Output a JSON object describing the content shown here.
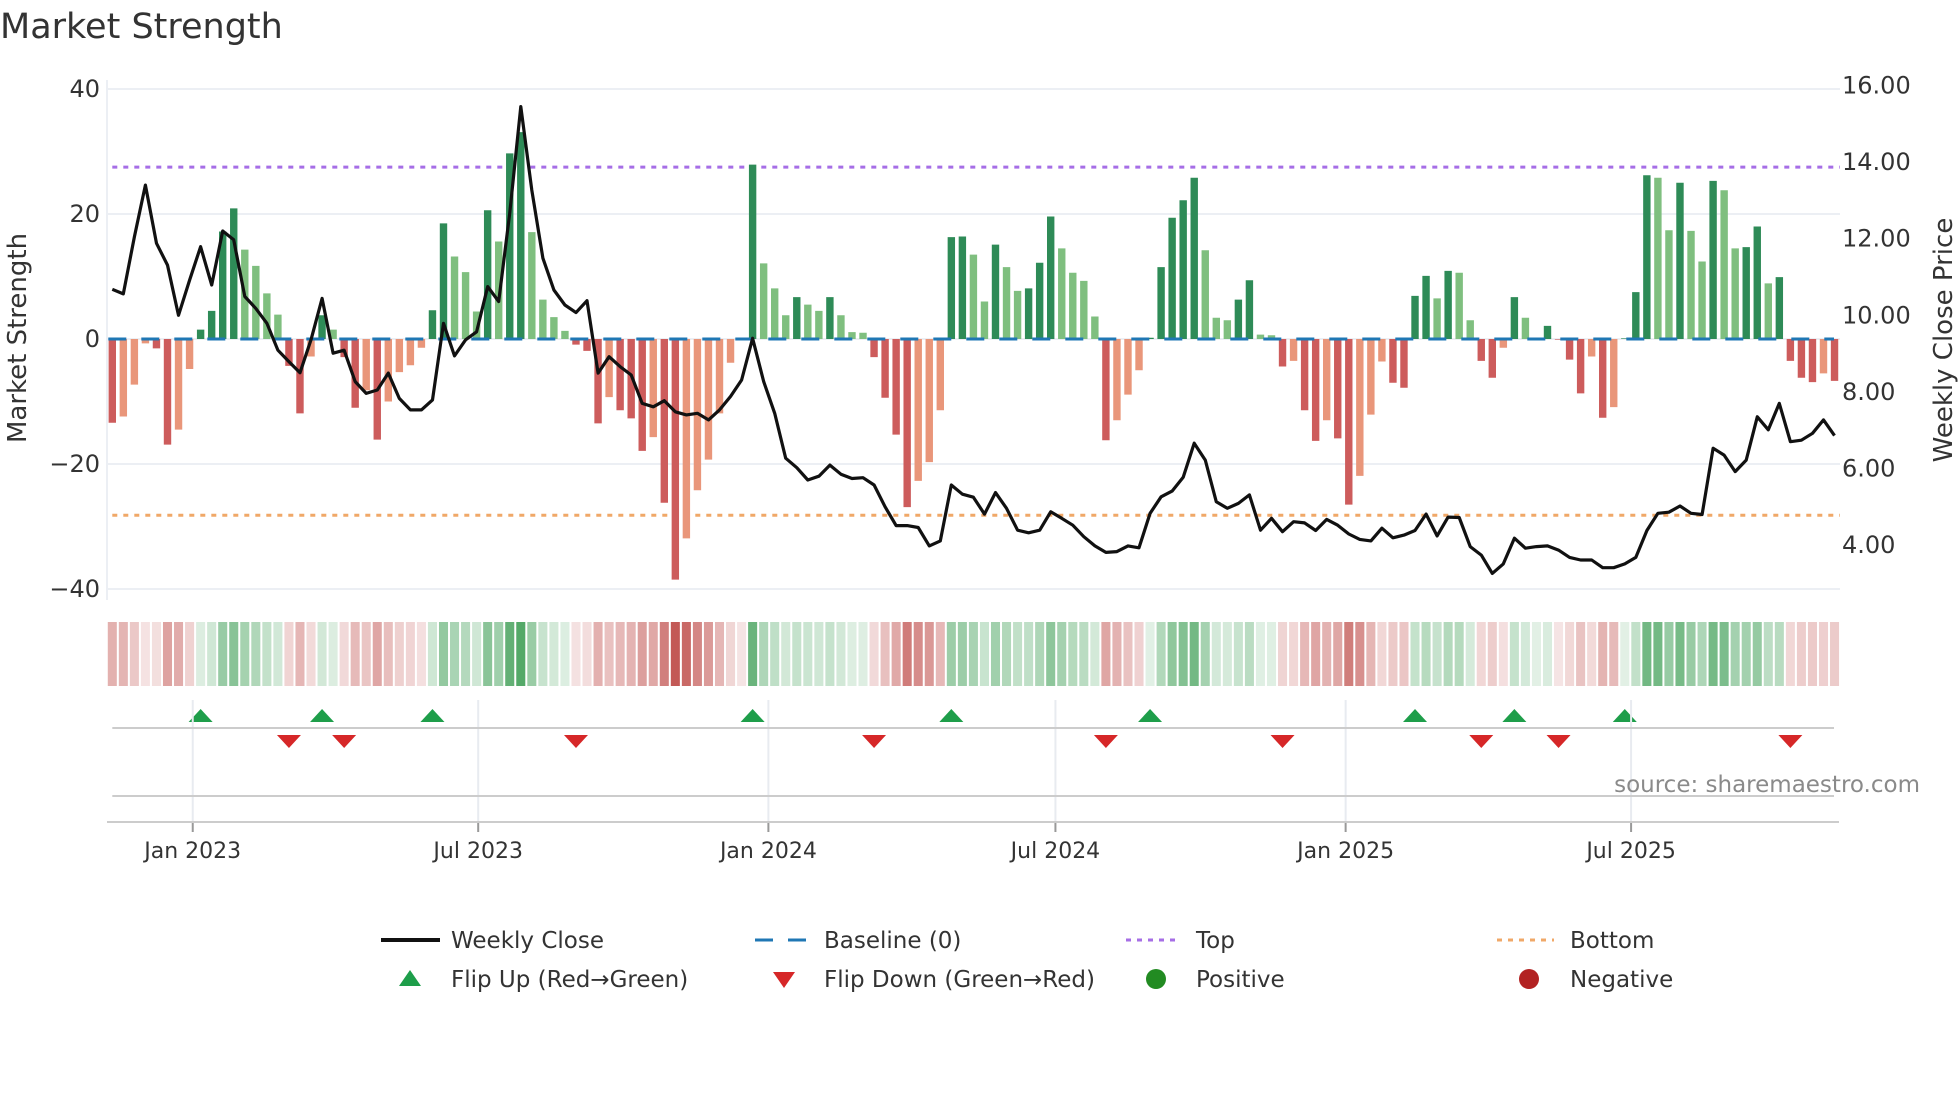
{
  "chart_data": {
    "type": "bar",
    "title": "Market Strength",
    "source": "source: sharemaestro.com",
    "x_start_week": "2022-11-11",
    "x_step_days": 7,
    "x_ticks": [
      {
        "date": "2023-01-01",
        "label": "Jan 2023"
      },
      {
        "date": "2023-07-01",
        "label": "Jul 2023"
      },
      {
        "date": "2024-01-01",
        "label": "Jan 2024"
      },
      {
        "date": "2024-07-01",
        "label": "Jul 2024"
      },
      {
        "date": "2025-01-01",
        "label": "Jan 2025"
      },
      {
        "date": "2025-07-01",
        "label": "Jul 2025"
      }
    ],
    "y_left": {
      "label": "Market Strength",
      "ylim": [
        -41.5,
        43
      ],
      "ticks": [
        40,
        20,
        0,
        -20,
        -40
      ],
      "tick_labels": [
        "40",
        "20",
        "0",
        "−20",
        "−40"
      ]
    },
    "y_right": {
      "label": "Weekly Close Price",
      "ylim": [
        2.62,
        16.4
      ],
      "ticks": [
        16,
        14,
        12,
        10,
        8,
        6,
        4
      ],
      "tick_labels": [
        "16.00",
        "14.00",
        "12.00",
        "10.00",
        "8.00",
        "6.00",
        "4.00"
      ]
    },
    "thresholds": {
      "top": 27.5,
      "bottom": -28.2,
      "baseline": 0
    },
    "strength": [
      -13.4,
      -12.4,
      -7.3,
      -0.7,
      -1.5,
      -16.9,
      -14.5,
      -4.8,
      1.5,
      4.5,
      17.2,
      20.9,
      14.3,
      11.7,
      7.3,
      3.9,
      -4.3,
      -11.9,
      -2.8,
      3.8,
      1.5,
      -2.9,
      -11.0,
      -8.2,
      -16.1,
      -10.0,
      -5.3,
      -4.2,
      -1.4,
      4.6,
      18.5,
      13.2,
      10.7,
      4.4,
      20.6,
      15.6,
      29.7,
      33.1,
      17.1,
      6.3,
      3.5,
      1.3,
      -0.9,
      -1.9,
      -13.5,
      -9.3,
      -11.4,
      -12.7,
      -17.9,
      -15.7,
      -26.2,
      -38.5,
      -31.9,
      -24.2,
      -19.3,
      -11.9,
      -3.8,
      -0.1,
      27.9,
      12.1,
      8.1,
      3.8,
      6.7,
      5.5,
      4.5,
      6.7,
      3.8,
      1.1,
      1.0,
      -2.9,
      -9.4,
      -15.3,
      -26.9,
      -22.7,
      -19.7,
      -11.4,
      16.3,
      16.4,
      13.5,
      6.0,
      15.1,
      11.5,
      7.7,
      8.1,
      12.2,
      19.6,
      14.5,
      10.6,
      9.3,
      3.6,
      -16.2,
      -13.0,
      -8.9,
      -5.0,
      0.2,
      11.5,
      19.4,
      22.2,
      25.8,
      14.2,
      3.4,
      3.0,
      6.3,
      9.4,
      0.7,
      0.6,
      -4.4,
      -3.5,
      -11.4,
      -16.3,
      -13.0,
      -15.9,
      -26.5,
      -21.9,
      -12.1,
      -3.6,
      -7.0,
      -7.8,
      6.9,
      10.1,
      6.5,
      10.9,
      10.6,
      3.0,
      -3.5,
      -6.2,
      -1.4,
      6.7,
      3.4,
      0.1,
      2.1,
      -0.1,
      -3.3,
      -8.7,
      -2.8,
      -12.6,
      -10.9,
      0.1,
      7.5,
      26.2,
      25.8,
      17.4,
      25.0,
      17.3,
      12.4,
      25.3,
      23.8,
      14.5,
      14.7,
      18.0,
      8.9,
      9.9,
      -3.5,
      -6.2,
      -6.9,
      -5.5,
      -6.7
    ],
    "weekly_close": [
      10.68,
      10.56,
      12.05,
      13.4,
      11.88,
      11.31,
      10.0,
      10.92,
      11.79,
      10.79,
      12.2,
      11.97,
      10.49,
      10.18,
      9.79,
      9.09,
      8.79,
      8.5,
      9.36,
      10.44,
      9.01,
      9.09,
      8.27,
      7.96,
      8.05,
      8.49,
      7.83,
      7.53,
      7.53,
      7.79,
      9.79,
      8.94,
      9.36,
      9.57,
      10.75,
      10.36,
      12.66,
      15.45,
      13.27,
      11.49,
      10.66,
      10.27,
      10.07,
      10.38,
      8.49,
      8.92,
      8.66,
      8.44,
      7.7,
      7.61,
      7.77,
      7.48,
      7.4,
      7.44,
      7.27,
      7.53,
      7.88,
      8.31,
      9.4,
      8.27,
      7.44,
      6.27,
      6.02,
      5.7,
      5.8,
      6.09,
      5.85,
      5.74,
      5.76,
      5.57,
      5.0,
      4.51,
      4.51,
      4.46,
      3.98,
      4.11,
      5.57,
      5.33,
      5.25,
      4.81,
      5.37,
      4.96,
      4.39,
      4.32,
      4.39,
      4.87,
      4.7,
      4.52,
      4.22,
      3.98,
      3.81,
      3.83,
      3.98,
      3.93,
      4.83,
      5.26,
      5.41,
      5.77,
      6.66,
      6.22,
      5.13,
      4.96,
      5.09,
      5.31,
      4.39,
      4.7,
      4.35,
      4.61,
      4.58,
      4.38,
      4.67,
      4.52,
      4.29,
      4.15,
      4.11,
      4.44,
      4.19,
      4.26,
      4.38,
      4.81,
      4.24,
      4.73,
      4.72,
      3.96,
      3.74,
      3.26,
      3.51,
      4.18,
      3.92,
      3.96,
      3.98,
      3.87,
      3.68,
      3.61,
      3.61,
      3.41,
      3.41,
      3.51,
      3.68,
      4.38,
      4.83,
      4.86,
      5.02,
      4.83,
      4.8,
      6.53,
      6.35,
      5.92,
      6.22,
      7.35,
      7.01,
      7.7,
      6.7,
      6.74,
      6.92,
      7.27,
      6.86
    ],
    "flip_up_weeks": [
      8,
      19,
      29,
      58,
      76,
      94,
      118,
      127,
      137
    ],
    "flip_down_weeks": [
      16,
      21,
      42,
      69,
      90,
      106,
      124,
      131,
      152
    ],
    "legend": [
      {
        "label": "Weekly Close",
        "kind": "line"
      },
      {
        "label": "Baseline (0)",
        "kind": "dash"
      },
      {
        "label": "Top",
        "kind": "dot-top"
      },
      {
        "label": "Bottom",
        "kind": "dot-bottom"
      },
      {
        "label": "Flip Up (Red→Green)",
        "kind": "tri-up"
      },
      {
        "label": "Flip Down (Green→Red)",
        "kind": "tri-down"
      },
      {
        "label": "Positive",
        "kind": "dot-pos"
      },
      {
        "label": "Negative",
        "kind": "dot-neg"
      }
    ],
    "legend_placement": "bottom",
    "colors": {
      "pos_rising": "#2e8b57",
      "pos_falling": "#7fbf7f",
      "neg_falling": "#cd5c5c",
      "neg_rising": "#e9967a",
      "price": "#111111",
      "baseline": "#1f77b4",
      "top": "#a66ee6",
      "bottom": "#f0a868",
      "flip_up": "#1e9e4a",
      "flip_down": "#d62728",
      "positive": "#228b22",
      "negative": "#b22222",
      "heat_pos": "#3e9e55",
      "heat_neg": "#c0504d"
    }
  }
}
